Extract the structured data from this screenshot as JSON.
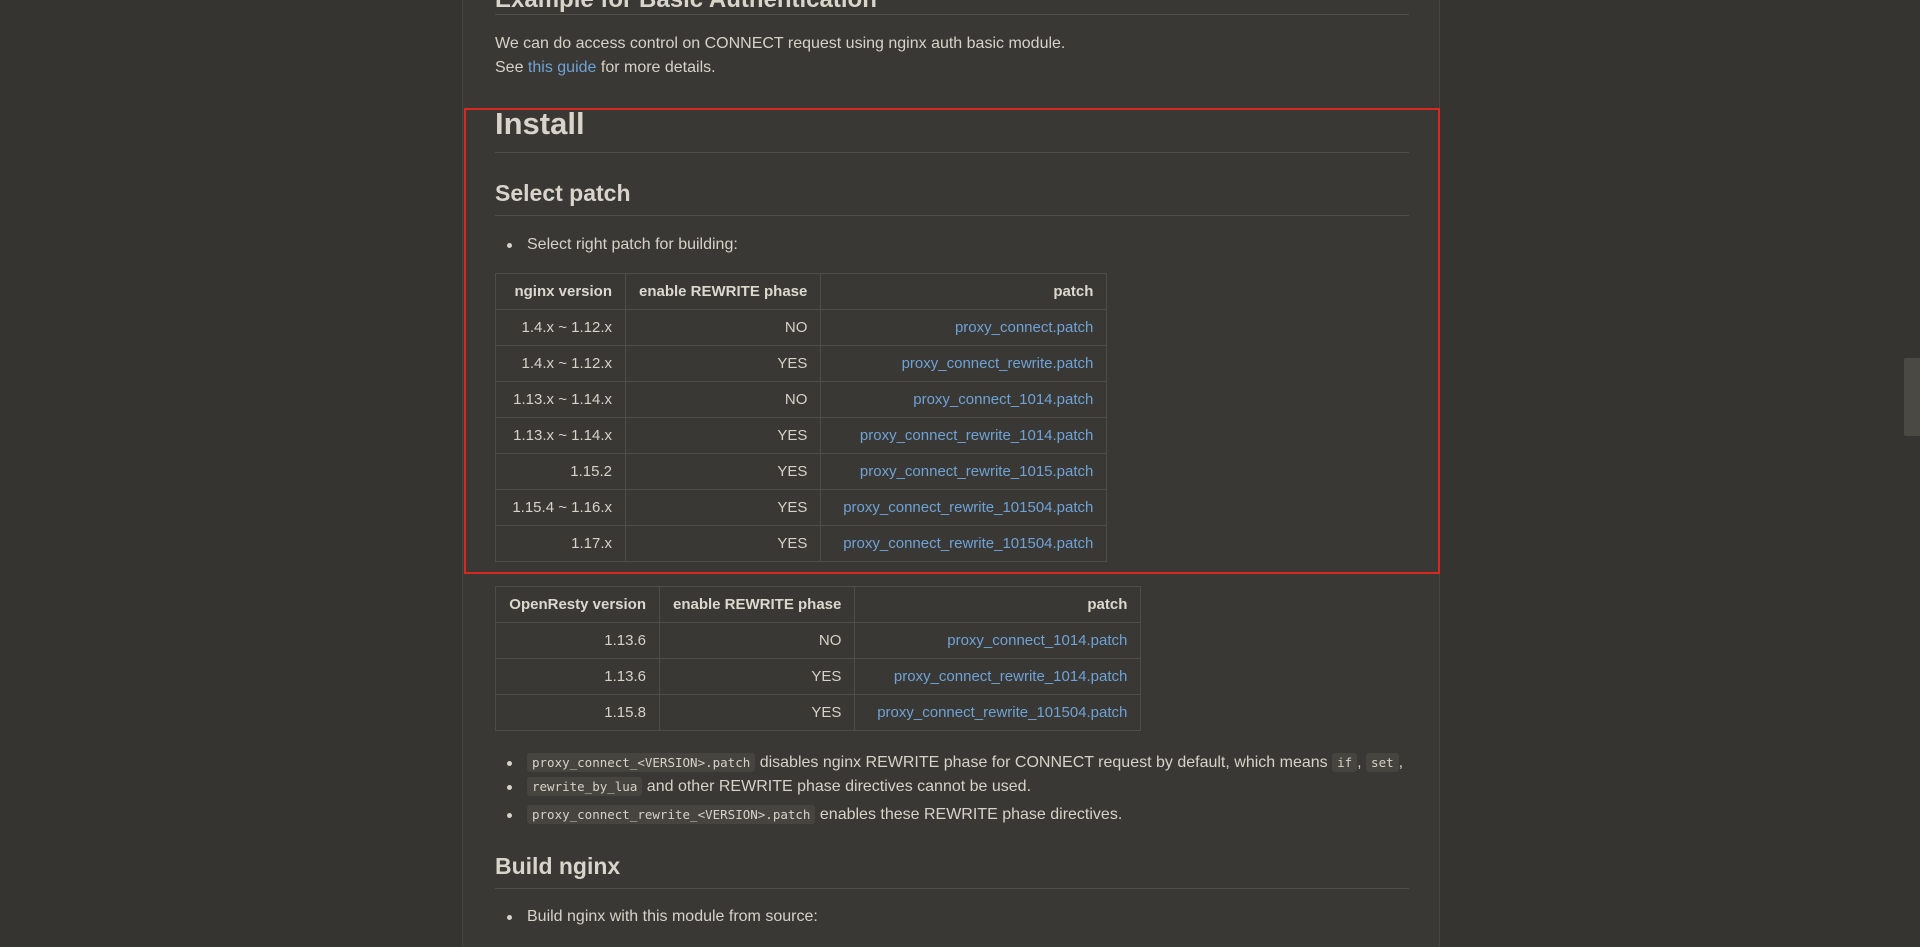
{
  "prev_section": {
    "heading": "Example for Basic Authentication",
    "line1": "We can do access control on CONNECT request using nginx auth basic module.",
    "line2_prefix": "See ",
    "line2_link": "this guide",
    "line2_suffix": " for more details."
  },
  "install": {
    "title": "Install",
    "select_patch": {
      "title": "Select patch",
      "bullet": "Select right patch for building:",
      "nginx_table": {
        "headers": [
          "nginx version",
          "enable REWRITE phase",
          "patch"
        ],
        "rows": [
          [
            "1.4.x ~ 1.12.x",
            "NO",
            "proxy_connect.patch"
          ],
          [
            "1.4.x ~ 1.12.x",
            "YES",
            "proxy_connect_rewrite.patch"
          ],
          [
            "1.13.x ~ 1.14.x",
            "NO",
            "proxy_connect_1014.patch"
          ],
          [
            "1.13.x ~ 1.14.x",
            "YES",
            "proxy_connect_rewrite_1014.patch"
          ],
          [
            "1.15.2",
            "YES",
            "proxy_connect_rewrite_1015.patch"
          ],
          [
            "1.15.4 ~ 1.16.x",
            "YES",
            "proxy_connect_rewrite_101504.patch"
          ],
          [
            "1.17.x",
            "YES",
            "proxy_connect_rewrite_101504.patch"
          ]
        ]
      },
      "openresty_table": {
        "headers": [
          "OpenResty version",
          "enable REWRITE phase",
          "patch"
        ],
        "rows": [
          [
            "1.13.6",
            "NO",
            "proxy_connect_1014.patch"
          ],
          [
            "1.13.6",
            "YES",
            "proxy_connect_rewrite_1014.patch"
          ],
          [
            "1.15.8",
            "YES",
            "proxy_connect_rewrite_101504.patch"
          ]
        ]
      },
      "note1": {
        "code1": "proxy_connect_<VERSION>.patch",
        "text1": " disables nginx REWRITE phase for CONNECT request by default, which means ",
        "code2": "if",
        "sep1": ", ",
        "code3": "set",
        "sep2": ",",
        "code4": "rewrite_by_lua",
        "text2": " and other REWRITE phase directives cannot be used."
      },
      "note2": {
        "code1": "proxy_connect_rewrite_<VERSION>.patch",
        "text1": " enables these REWRITE phase directives."
      }
    },
    "build": {
      "title": "Build nginx",
      "bullet": "Build nginx with this module from source:"
    }
  },
  "colors": {
    "background": "#353431",
    "page": "#393834",
    "link": "#6fa2d6",
    "highlight": "#d9281f"
  }
}
